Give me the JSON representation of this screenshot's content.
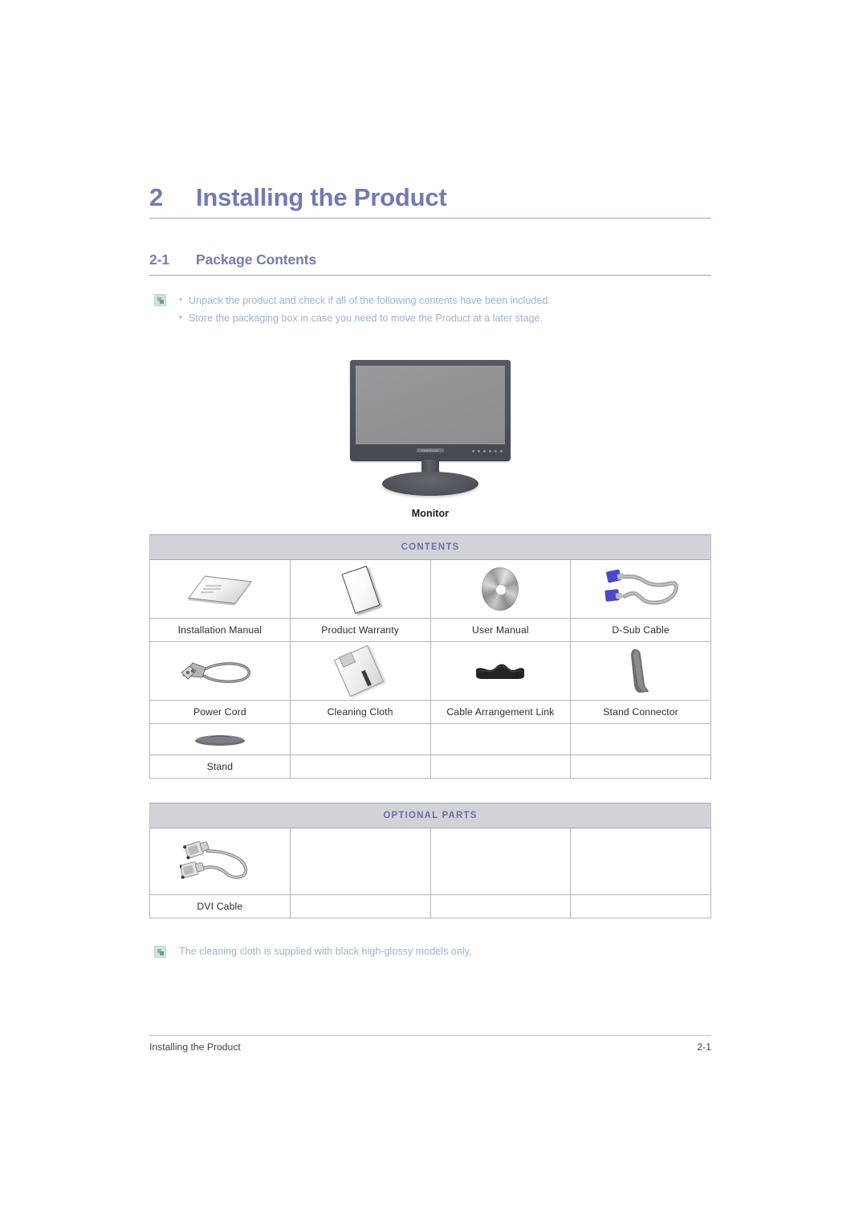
{
  "document": {
    "chapter_number": "2",
    "chapter_title": "Installing the Product",
    "section_number": "2-1",
    "section_title": "Package Contents"
  },
  "intro_notes": {
    "icon": "note-icon",
    "items": [
      "Unpack the product and check if all of the following contents have been included.",
      "Store the packaging box in case you need to move the Product at a later stage."
    ]
  },
  "hero": {
    "image_alt": "monitor-illustration",
    "brand_logo": "SAMSUNG",
    "caption": "Monitor"
  },
  "tables": [
    {
      "id": "contents",
      "header": "CONTENTS",
      "rows": [
        [
          {
            "icon": "installation-manual-icon",
            "label": "Installation Manual"
          },
          {
            "icon": "product-warranty-icon",
            "label": "Product Warranty"
          },
          {
            "icon": "user-manual-cd-icon",
            "label": "User Manual"
          },
          {
            "icon": "d-sub-cable-icon",
            "label": "D-Sub Cable"
          }
        ],
        [
          {
            "icon": "power-cord-icon",
            "label": "Power Cord"
          },
          {
            "icon": "cleaning-cloth-icon",
            "label": "Cleaning Cloth"
          },
          {
            "icon": "cable-arrangement-link-icon",
            "label": "Cable Arrangement Link"
          },
          {
            "icon": "stand-connector-icon",
            "label": "Stand Connector"
          }
        ],
        [
          {
            "icon": "stand-icon",
            "label": "Stand"
          },
          {
            "icon": "",
            "label": ""
          },
          {
            "icon": "",
            "label": ""
          },
          {
            "icon": "",
            "label": ""
          }
        ]
      ]
    },
    {
      "id": "optional",
      "header": "OPTIONAL PARTS",
      "rows": [
        [
          {
            "icon": "dvi-cable-icon",
            "label": "DVI Cable"
          },
          {
            "icon": "",
            "label": ""
          },
          {
            "icon": "",
            "label": ""
          },
          {
            "icon": "",
            "label": ""
          }
        ]
      ]
    }
  ],
  "bottom_note": {
    "icon": "note-icon",
    "text": "The cleaning cloth is supplied with black high-glossy models only."
  },
  "footer": {
    "left": "Installing the Product",
    "right": "2-1"
  },
  "colors": {
    "heading": "#7379b5",
    "band_text": "#6a70ad",
    "band_bg": "#d2d3d6",
    "note_text": "#9cb3cb",
    "rule": "#9ea3cb",
    "body_text": "#2b2b2b"
  }
}
